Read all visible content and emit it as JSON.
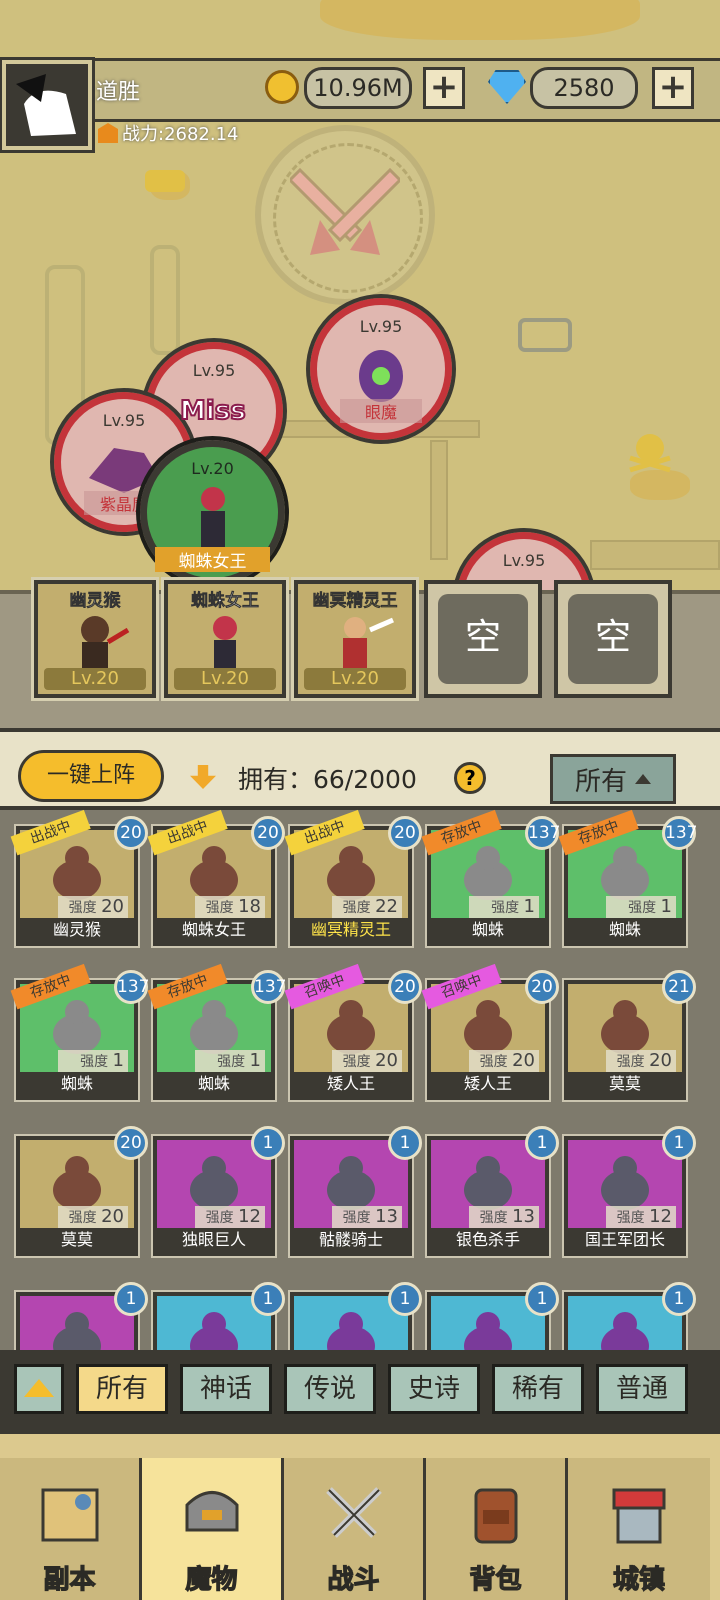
{
  "player": {
    "name": "道胜",
    "power_label": "战力:2682.14"
  },
  "resources": {
    "gold": "10.96M",
    "gems": "2580",
    "plus": "+"
  },
  "battle": {
    "enemies": [
      {
        "level": "Lv.95",
        "name": "眼魔"
      },
      {
        "level": "Lv.95",
        "name": ""
      },
      {
        "level": "Lv.95",
        "name": "紫晶魔"
      },
      {
        "level": "Lv.95",
        "name": ""
      }
    ],
    "ally": {
      "level": "Lv.20",
      "name": "蜘蛛女王"
    },
    "miss_text": "Miss"
  },
  "lineup": [
    {
      "name": "幽灵猴",
      "level": "Lv.20"
    },
    {
      "name": "蜘蛛女王",
      "level": "Lv.20"
    },
    {
      "name": "幽冥精灵王",
      "level": "Lv.20"
    },
    {
      "name": "空"
    },
    {
      "name": "空"
    }
  ],
  "controls": {
    "one_key": "一键上阵",
    "own_label": "拥有：66/2000",
    "help": "?",
    "filter": "所有"
  },
  "cards": [
    {
      "name": "幽灵猴",
      "count": "20",
      "strength": "20",
      "tag": "出战中",
      "color": "gold"
    },
    {
      "name": "蜘蛛女王",
      "count": "20",
      "strength": "18",
      "tag": "出战中",
      "color": "gold"
    },
    {
      "name": "幽冥精灵王",
      "count": "20",
      "strength": "22",
      "tag": "出战中",
      "color": "gold"
    },
    {
      "name": "蜘蛛",
      "count": "137",
      "strength": "1",
      "tag": "存放中",
      "color": "green"
    },
    {
      "name": "蜘蛛",
      "count": "137",
      "strength": "1",
      "tag": "存放中",
      "color": "green"
    },
    {
      "name": "蜘蛛",
      "count": "137",
      "strength": "1",
      "tag": "存放中",
      "color": "green"
    },
    {
      "name": "蜘蛛",
      "count": "137",
      "strength": "1",
      "tag": "存放中",
      "color": "green"
    },
    {
      "name": "矮人王",
      "count": "20",
      "strength": "20",
      "tag": "召唤中",
      "color": "gold"
    },
    {
      "name": "矮人王",
      "count": "20",
      "strength": "20",
      "tag": "召唤中",
      "color": "gold"
    },
    {
      "name": "莫莫",
      "count": "21",
      "strength": "20",
      "tag": "",
      "color": "gold"
    },
    {
      "name": "莫莫",
      "count": "20",
      "strength": "20",
      "tag": "",
      "color": "gold"
    },
    {
      "name": "独眼巨人",
      "count": "1",
      "strength": "12",
      "tag": "",
      "color": "purple"
    },
    {
      "name": "骷髅骑士",
      "count": "1",
      "strength": "13",
      "tag": "",
      "color": "purple"
    },
    {
      "name": "银色杀手",
      "count": "1",
      "strength": "13",
      "tag": "",
      "color": "purple"
    },
    {
      "name": "国王军团长",
      "count": "1",
      "strength": "12",
      "tag": "",
      "color": "purple"
    },
    {
      "name": "",
      "count": "1",
      "strength": "",
      "tag": "",
      "color": "purple"
    },
    {
      "name": "",
      "count": "1",
      "strength": "",
      "tag": "",
      "color": "blue"
    },
    {
      "name": "",
      "count": "1",
      "strength": "",
      "tag": "",
      "color": "blue"
    },
    {
      "name": "",
      "count": "1",
      "strength": "",
      "tag": "",
      "color": "blue"
    },
    {
      "name": "",
      "count": "1",
      "strength": "",
      "tag": "",
      "color": "blue"
    }
  ],
  "strength_label": "强度",
  "rarity_tabs": [
    "所有",
    "神话",
    "传说",
    "史诗",
    "稀有",
    "普通"
  ],
  "nav": [
    "副本",
    "魔物",
    "战斗",
    "背包",
    "城镇"
  ],
  "colors": {
    "accent": "#f5bd2c",
    "dark": "#3b3932",
    "enemy_ring": "#c4343a"
  }
}
